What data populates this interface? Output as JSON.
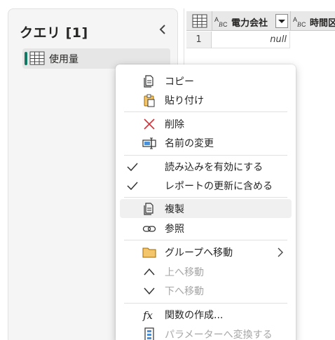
{
  "queries": {
    "title": "クエリ [1]",
    "items": [
      {
        "label": "使用量",
        "selected": true
      }
    ]
  },
  "grid": {
    "columns": [
      {
        "type_label": "ABC",
        "name": "電力会社"
      },
      {
        "type_label": "ABC",
        "name": "時間区"
      }
    ],
    "rows": [
      {
        "num": "1",
        "cells": [
          "null"
        ]
      }
    ]
  },
  "context_menu": {
    "items": [
      {
        "label": "コピー",
        "icon": "copy-icon"
      },
      {
        "label": "貼り付け",
        "icon": "paste-icon"
      },
      {
        "label": "削除",
        "icon": "delete-icon"
      },
      {
        "label": "名前の変更",
        "icon": "rename-icon"
      },
      {
        "label": "読み込みを有効にする",
        "checked": true
      },
      {
        "label": "レポートの更新に含める",
        "checked": true
      },
      {
        "label": "複製",
        "icon": "duplicate-icon",
        "highlighted": true
      },
      {
        "label": "参照",
        "icon": "reference-icon"
      },
      {
        "label": "グループへ移動",
        "icon": "folder-icon",
        "submenu": true
      },
      {
        "label": "上へ移動",
        "icon": "chevron-up-icon",
        "disabled": true
      },
      {
        "label": "下へ移動",
        "icon": "chevron-down-icon",
        "disabled": true
      },
      {
        "label": "関数の作成...",
        "icon": "function-icon"
      },
      {
        "label": "パラメーターへ変換する",
        "icon": "parameter-icon",
        "disabled": true
      }
    ]
  },
  "colors": {
    "accent": "#117865",
    "folder": "#f3c66b",
    "delete": "#d13438",
    "highlight": "#f0f0f0"
  }
}
